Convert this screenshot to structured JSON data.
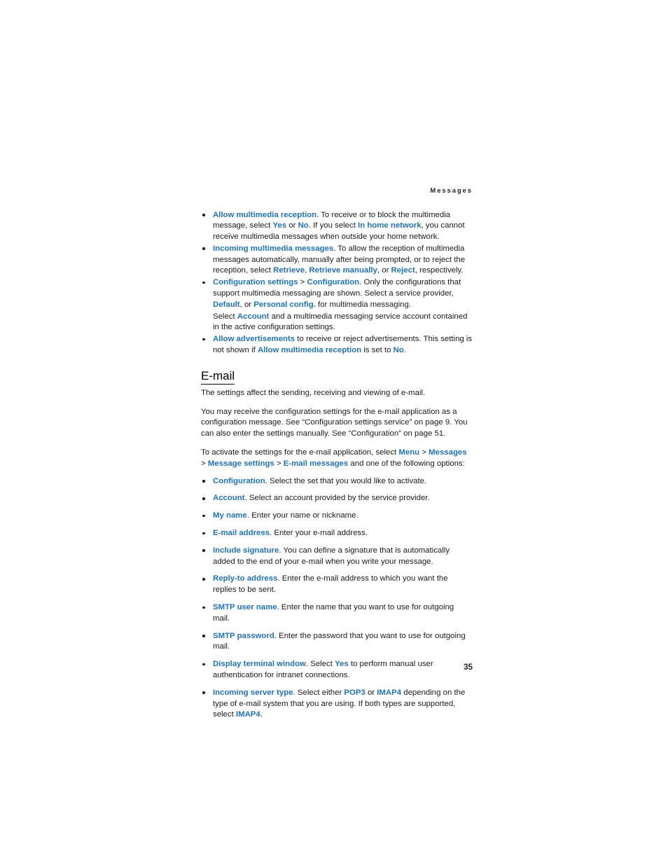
{
  "document": {
    "running_header": "Messages",
    "page_number": "35",
    "accent_color": "#1b73c4",
    "text_color": "#1a1a1a"
  },
  "mms_bullets": [
    {
      "id": "allow-multimedia-reception",
      "runs": [
        {
          "t": "Allow multimedia reception",
          "s": "ui"
        },
        {
          "t": ". To receive or to block the multimedia message, select ",
          "s": "plain"
        },
        {
          "t": "Yes",
          "s": "ui"
        },
        {
          "t": " or ",
          "s": "plain"
        },
        {
          "t": "No",
          "s": "ui"
        },
        {
          "t": ". If you select ",
          "s": "plain"
        },
        {
          "t": "In home network",
          "s": "ui"
        },
        {
          "t": ", you cannot receive multimedia messages when outside your home network.",
          "s": "plain"
        }
      ]
    },
    {
      "id": "incoming-multimedia-messages",
      "runs": [
        {
          "t": "Incoming multimedia messages",
          "s": "ui"
        },
        {
          "t": ". To allow the reception of multimedia messages automatically, manually after being prompted, or to reject the reception, select ",
          "s": "plain"
        },
        {
          "t": "Retrieve",
          "s": "ui"
        },
        {
          "t": ", ",
          "s": "plain"
        },
        {
          "t": "Retrieve manually",
          "s": "ui"
        },
        {
          "t": ", or ",
          "s": "plain"
        },
        {
          "t": "Reject",
          "s": "ui"
        },
        {
          "t": ", respectively.",
          "s": "plain"
        }
      ]
    },
    {
      "id": "configuration-settings",
      "runs": [
        {
          "t": "Configuration settings",
          "s": "ui"
        },
        {
          "t": " > ",
          "s": "plain"
        },
        {
          "t": "Configuration",
          "s": "ui"
        },
        {
          "t": ". Only the configurations that support multimedia messaging are shown. Select a service provider, ",
          "s": "plain"
        },
        {
          "t": "Default",
          "s": "ui"
        },
        {
          "t": ", or ",
          "s": "plain"
        },
        {
          "t": "Personal config.",
          "s": "ui"
        },
        {
          "t": " for multimedia messaging.",
          "s": "plain"
        }
      ]
    }
  ],
  "mms_subparagraph": {
    "id": "select-account-note",
    "runs": [
      {
        "t": "Select ",
        "s": "plain"
      },
      {
        "t": "Account",
        "s": "ui"
      },
      {
        "t": " and a multimedia messaging service account contained in the active configuration settings.",
        "s": "plain"
      }
    ]
  },
  "mms_bullets_tail": [
    {
      "id": "allow-advertisements",
      "runs": [
        {
          "t": "Allow advertisements",
          "s": "ui"
        },
        {
          "t": " to receive or reject advertisements. This setting is not shown if ",
          "s": "plain"
        },
        {
          "t": "Allow multimedia reception",
          "s": "ui"
        },
        {
          "t": " is set to ",
          "s": "plain"
        },
        {
          "t": "No",
          "s": "ui"
        },
        {
          "t": ".",
          "s": "plain"
        }
      ]
    }
  ],
  "email_section": {
    "heading": "E-mail",
    "intro": [
      {
        "id": "email-intro-1",
        "runs": [
          {
            "t": "The settings affect the sending, receiving and viewing of e-mail.",
            "s": "plain"
          }
        ]
      },
      {
        "id": "email-intro-2",
        "runs": [
          {
            "t": "You may receive the configuration settings for the e-mail application as a configuration message. See “Configuration settings service” on page 9. You can also enter the settings manually. See “Configuration” on page 51.",
            "s": "plain"
          }
        ]
      },
      {
        "id": "email-activate",
        "runs": [
          {
            "t": "To activate the settings for the e-mail application, select ",
            "s": "plain"
          },
          {
            "t": "Menu",
            "s": "ui"
          },
          {
            "t": " > ",
            "s": "plain"
          },
          {
            "t": "Messages",
            "s": "ui"
          },
          {
            "t": " > ",
            "s": "plain"
          },
          {
            "t": "Message settings",
            "s": "ui"
          },
          {
            "t": " > ",
            "s": "plain"
          },
          {
            "t": "E-mail messages",
            "s": "ui"
          },
          {
            "t": " and one of the following options:",
            "s": "plain"
          }
        ]
      }
    ],
    "options": [
      {
        "id": "option-configuration",
        "runs": [
          {
            "t": "Configuration",
            "s": "ui"
          },
          {
            "t": ". Select the set that you would like to activate.",
            "s": "plain"
          }
        ]
      },
      {
        "id": "option-account",
        "runs": [
          {
            "t": "Account",
            "s": "ui"
          },
          {
            "t": ". Select an account provided by the service provider.",
            "s": "plain"
          }
        ]
      },
      {
        "id": "option-my-name",
        "runs": [
          {
            "t": "My name",
            "s": "ui"
          },
          {
            "t": ". Enter your name or nickname.",
            "s": "plain"
          }
        ]
      },
      {
        "id": "option-e-mail-address",
        "runs": [
          {
            "t": "E-mail address",
            "s": "ui"
          },
          {
            "t": ". Enter your e-mail address.",
            "s": "plain"
          }
        ]
      },
      {
        "id": "option-include-signature",
        "runs": [
          {
            "t": "Include signature",
            "s": "ui"
          },
          {
            "t": ". You can define a signature that is automatically added to the end of your e-mail when you write your message.",
            "s": "plain"
          }
        ]
      },
      {
        "id": "option-reply-to-address",
        "runs": [
          {
            "t": "Reply-to address",
            "s": "ui"
          },
          {
            "t": ". Enter the e-mail address to which you want the replies to be sent.",
            "s": "plain"
          }
        ]
      },
      {
        "id": "option-smtp-user-name",
        "runs": [
          {
            "t": "SMTP user name",
            "s": "ui"
          },
          {
            "t": ". Enter the name that you want to use for outgoing mail.",
            "s": "plain"
          }
        ]
      },
      {
        "id": "option-smtp-password",
        "runs": [
          {
            "t": "SMTP password",
            "s": "ui"
          },
          {
            "t": ". Enter the password that you want to use for outgoing mail.",
            "s": "plain"
          }
        ]
      },
      {
        "id": "option-display-terminal-window",
        "runs": [
          {
            "t": "Display terminal window",
            "s": "ui"
          },
          {
            "t": ". Select ",
            "s": "plain"
          },
          {
            "t": "Yes",
            "s": "ui"
          },
          {
            "t": " to perform manual user authentication for intranet connections.",
            "s": "plain"
          }
        ]
      },
      {
        "id": "option-incoming-server-type",
        "runs": [
          {
            "t": "Incoming server type",
            "s": "ui"
          },
          {
            "t": ". Select either ",
            "s": "plain"
          },
          {
            "t": "POP3",
            "s": "ui"
          },
          {
            "t": " or ",
            "s": "plain"
          },
          {
            "t": "IMAP4",
            "s": "ui"
          },
          {
            "t": " depending on the type of e-mail system that you are using. If both types are supported, select ",
            "s": "plain"
          },
          {
            "t": "IMAP4",
            "s": "ui"
          },
          {
            "t": ".",
            "s": "plain"
          }
        ]
      }
    ]
  }
}
